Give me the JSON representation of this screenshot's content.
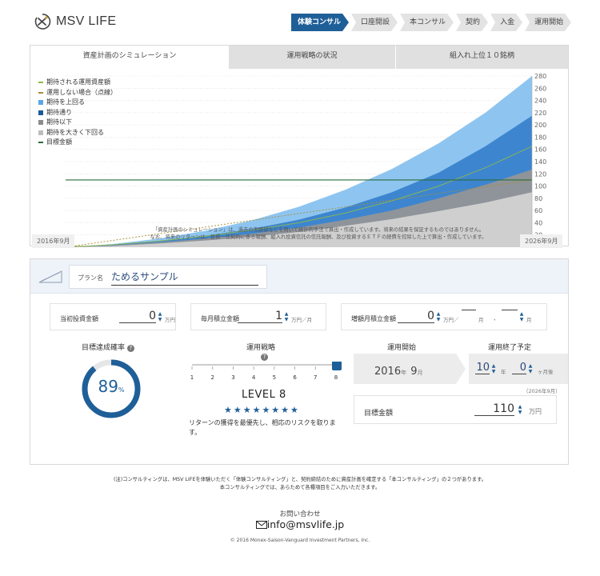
{
  "header": {
    "logo_text": "MSV LIFE",
    "steps": [
      "体験コンサル",
      "口座開設",
      "本コンサル",
      "契約",
      "入金",
      "運用開始"
    ],
    "active_step": 0
  },
  "simulation": {
    "tabs": [
      "資産計画のシミュレーション",
      "運用戦略の状況",
      "組入れ上位１０銘柄"
    ],
    "legend": [
      {
        "label": "期待される運用資産額",
        "color": "#8fb84a",
        "kind": "line"
      },
      {
        "label": "運用しない場合（点線）",
        "color": "#a98d35",
        "kind": "line"
      },
      {
        "label": "期待を上回る",
        "color": "#5aa5e6",
        "kind": "box"
      },
      {
        "label": "期待通り",
        "color": "#1b5a97",
        "kind": "box"
      },
      {
        "label": "期待以下",
        "color": "#8c8c8c",
        "kind": "box"
      },
      {
        "label": "期待を大きく下回る",
        "color": "#bdbdbd",
        "kind": "box"
      },
      {
        "label": "目標金額",
        "color": "#2a6b3c",
        "kind": "line"
      }
    ],
    "start_date": "2016年9月",
    "end_date": "2026年9月",
    "note_line1": "「資産計画のシミュレーション」は、過去の実績値などを用いて統計的手法で算出・作成しています。将来の結果を保証するものではありません。",
    "note_line2": "なお、将来のリターンは、投資一任契約に係る報酬、組入れ投資信託の信託報酬、及び投資するＥＴＦの経費を控除した上で算出・作成しています。"
  },
  "chart_data": {
    "type": "area",
    "x": [
      0,
      1,
      2,
      3,
      4,
      5,
      6,
      7,
      8,
      9,
      10
    ],
    "x_start_label": "2016年9月",
    "x_end_label": "2026年9月",
    "ylabel": "万円",
    "ylim": [
      0,
      280
    ],
    "ytick_step": 20,
    "series": [
      {
        "name": "期待を上回る",
        "values": [
          0,
          5,
          14,
          27,
          44,
          66,
          94,
          128,
          170,
          220,
          280
        ]
      },
      {
        "name": "期待通り",
        "values": [
          0,
          4,
          10,
          19,
          30,
          45,
          65,
          90,
          122,
          165,
          215
        ]
      },
      {
        "name": "期待以下",
        "values": [
          0,
          3,
          8,
          14,
          22,
          32,
          45,
          60,
          80,
          102,
          127
        ]
      },
      {
        "name": "期待を大きく下回る",
        "values": [
          0,
          2,
          6,
          11,
          17,
          25,
          35,
          46,
          59,
          73,
          90
        ]
      },
      {
        "name": "期待される運用資産額",
        "values": [
          0,
          4,
          10,
          18,
          28,
          40,
          56,
          76,
          100,
          130,
          165
        ]
      },
      {
        "name": "運用しない場合（点線）",
        "values": [
          0,
          11,
          22,
          33,
          44,
          55,
          66,
          77,
          88,
          99,
          110
        ]
      },
      {
        "name": "目標金額",
        "values": [
          110,
          110,
          110,
          110,
          110,
          110,
          110,
          110,
          110,
          110,
          110
        ]
      }
    ]
  },
  "plan": {
    "label": "プラン名",
    "name": "ためるサンプル"
  },
  "inputs": {
    "initial_label": "当初投資金額",
    "initial_value": "0",
    "initial_unit": "万円",
    "monthly_label": "毎月積立金額",
    "monthly_value": "1",
    "monthly_unit": "万円／月",
    "extra_label": "増額月積立金額",
    "extra_value": "0",
    "extra_unit": "万円／",
    "extra_month_unit": "月",
    "extra_sep": "・",
    "extra_month2_unit": "月"
  },
  "probability": {
    "title": "目標達成確率",
    "value": "89",
    "unit": "%",
    "fraction": 0.89
  },
  "strategy": {
    "title": "運用戦略",
    "ticks": [
      "1",
      "2",
      "3",
      "4",
      "5",
      "6",
      "7",
      "8"
    ],
    "selected": 8,
    "level_text": "LEVEL",
    "level_value": "8",
    "stars": "★★★★★★★★",
    "desc": "リターンの獲得を最優先し、相応のリスクを取りま す。"
  },
  "start": {
    "title": "運用開始",
    "year": "2016",
    "year_unit": "年",
    "month": "9",
    "month_unit": "月"
  },
  "end": {
    "title": "運用終了予定",
    "year": "10",
    "year_unit": "年",
    "month": "0",
    "month_unit": "ヶ月後",
    "date_note": "（2026年9月）"
  },
  "target": {
    "label": "目標金額",
    "value": "110",
    "unit": "万円"
  },
  "footer": {
    "note_line1": "(注)コンサルティングは、MSV LIFEを体験いただく「体験コンサルティング」と、契約締結のために資産計画を確定する「本コンサルティング」の２つがあります。",
    "note_line2": "本コンサルティングでは、あらためて各種項目をご入力いただきます。",
    "contact_title": "お問い合わせ",
    "contact_email": "info@msvlife.jp",
    "copyright": "© 2016 Monex-Saison-Vanguard Investment Partners, Inc."
  }
}
